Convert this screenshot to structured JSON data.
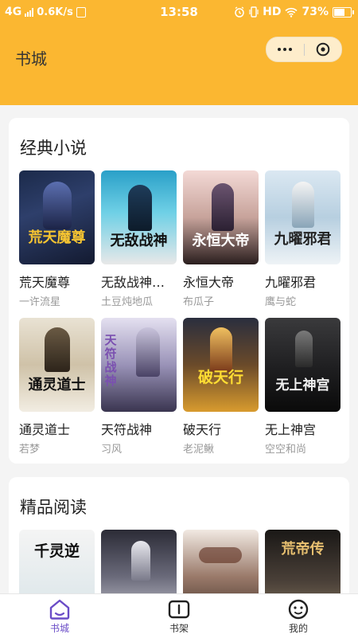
{
  "statusbar": {
    "network": "4G",
    "speed": "0.6K/s",
    "time": "13:58",
    "hd": "HD",
    "battery": "73%",
    "battery_level": 0.73
  },
  "header": {
    "title": "书城"
  },
  "sections": [
    {
      "title": "经典小说",
      "books": [
        {
          "title": "荒天魔尊",
          "author": "一许流星",
          "cover_text": "荒天魔尊"
        },
        {
          "title": "无敌战神…",
          "author": "土豆炖地瓜",
          "cover_text": "无敌战神"
        },
        {
          "title": "永恒大帝",
          "author": "布瓜子",
          "cover_text": "永恒大帝"
        },
        {
          "title": "九曜邪君",
          "author": "鹰与蛇",
          "cover_text": "九曜邪君"
        },
        {
          "title": "通灵道士",
          "author": "若梦",
          "cover_text": "通灵道士"
        },
        {
          "title": "天符战神",
          "author": "习风",
          "cover_text": "天符战神"
        },
        {
          "title": "破天行",
          "author": "老泥鳅",
          "cover_text": "破天行"
        },
        {
          "title": "无上神宫",
          "author": "空空和尚",
          "cover_text": "无上神宫"
        }
      ]
    },
    {
      "title": "精品阅读",
      "books": [
        {
          "cover_text": "千灵逆"
        },
        {
          "cover_text": ""
        },
        {
          "cover_text": ""
        },
        {
          "cover_text": "荒帝传"
        }
      ]
    }
  ],
  "tabbar": [
    {
      "label": "书城",
      "icon": "home-icon",
      "active": true
    },
    {
      "label": "书架",
      "icon": "bookshelf-icon",
      "active": false
    },
    {
      "label": "我的",
      "icon": "profile-icon",
      "active": false
    }
  ],
  "colors": {
    "header": "#fbb731",
    "tab_active": "#6a4cc7"
  }
}
